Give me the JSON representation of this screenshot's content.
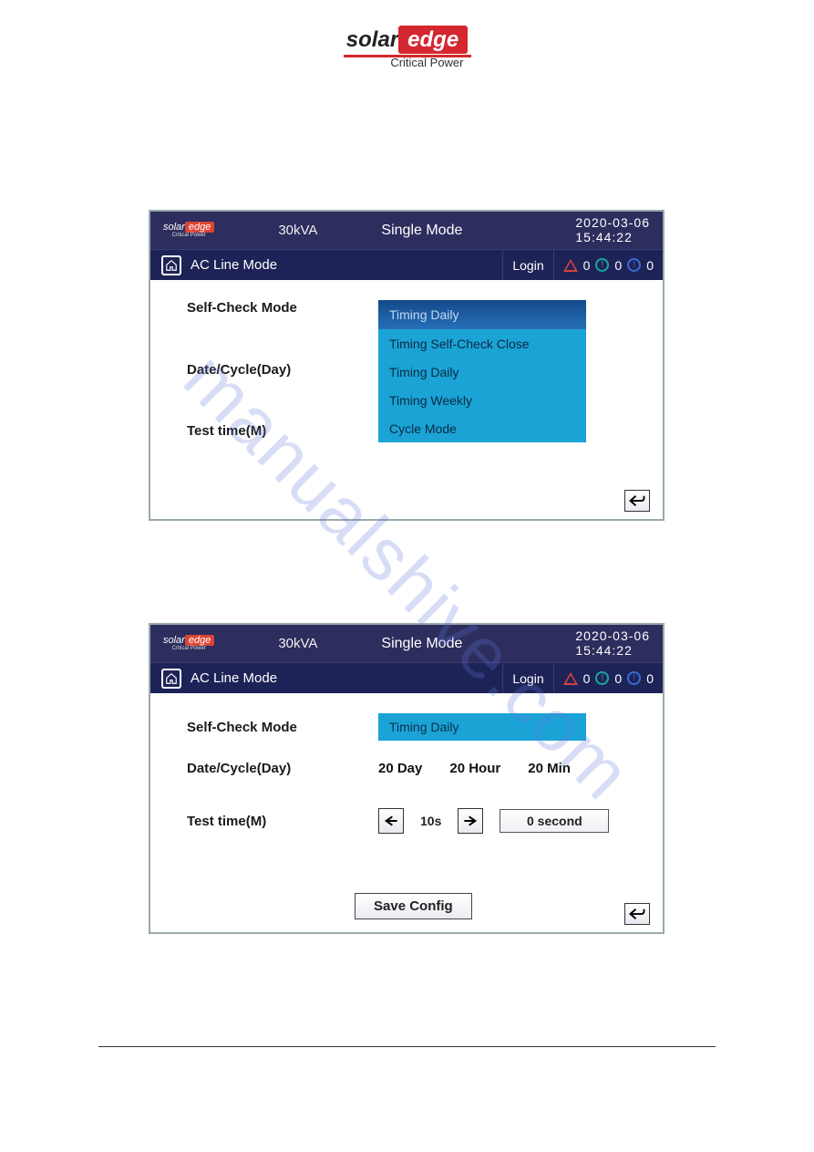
{
  "page": {
    "logo_brand_prefix": "solar",
    "logo_brand_suffix": "edge",
    "logo_subtitle": "Critical Power",
    "watermark": "manualshive.com"
  },
  "header": {
    "mini_logo_prefix": "solar",
    "mini_logo_suffix": "edge",
    "mini_logo_sub": "Critical Power",
    "kva": "30kVA",
    "mode": "Single  Mode",
    "date": "2020-03-06",
    "time": "15:44:22"
  },
  "subbar": {
    "mode_label": "AC Line Mode",
    "login": "Login",
    "warn_count": "0",
    "info1_count": "0",
    "info2_count": "0"
  },
  "labels": {
    "self_check": "Self-Check Mode",
    "date_cycle": "Date/Cycle(Day)",
    "test_time": "Test time(M)"
  },
  "screen1": {
    "dropdown": {
      "selected": "Timing Daily",
      "options": [
        "Timing Self-Check Close",
        "Timing Daily",
        "Timing Weekly",
        "Cycle Mode"
      ]
    }
  },
  "screen2": {
    "self_check_value": "Timing Daily",
    "date_day": "20  Day",
    "date_hour": "20  Hour",
    "date_min": "20 Min",
    "time_step": "10s",
    "time_value": "0 second",
    "save": "Save  Config"
  }
}
